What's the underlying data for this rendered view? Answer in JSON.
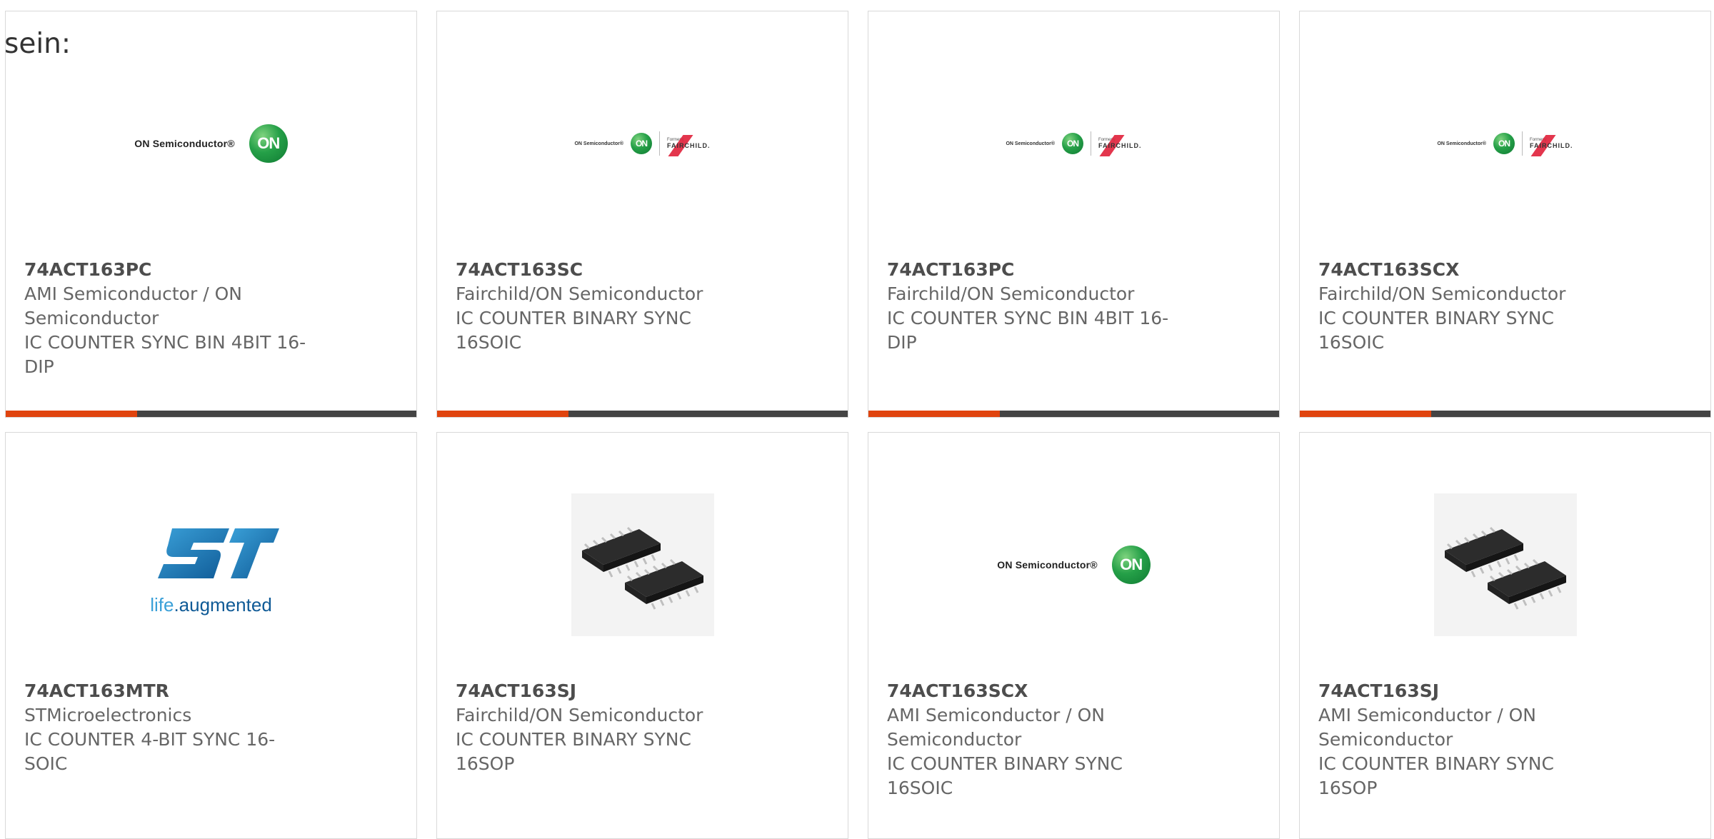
{
  "header_text": "sein:",
  "cards": [
    {
      "part": "74ACT163PC",
      "manufacturer": "AMI Semiconductor / ON Semiconductor",
      "description": "IC COUNTER SYNC BIN 4BIT 16-DIP",
      "logo": "on-semiconductor-logo",
      "logo_text": "ON Semiconductor®",
      "on_text": "ON",
      "progress": 0.32
    },
    {
      "part": "74ACT163SC",
      "manufacturer": "Fairchild/ON Semiconductor",
      "description": "IC COUNTER BINARY SYNC 16SOIC",
      "logo": "on-fairchild-logo",
      "logo_text": "ON Semiconductor®",
      "on_text": "ON",
      "formerly_text": "Formerly",
      "fairchild_text": "FAIRCHILD.",
      "progress": 0.32
    },
    {
      "part": "74ACT163PC",
      "manufacturer": "Fairchild/ON Semiconductor",
      "description": "IC COUNTER SYNC BIN 4BIT 16-DIP",
      "logo": "on-fairchild-logo",
      "logo_text": "ON Semiconductor®",
      "on_text": "ON",
      "formerly_text": "Formerly",
      "fairchild_text": "FAIRCHILD.",
      "progress": 0.32
    },
    {
      "part": "74ACT163SCX",
      "manufacturer": "Fairchild/ON Semiconductor",
      "description": "IC COUNTER BINARY SYNC 16SOIC",
      "logo": "on-fairchild-logo",
      "logo_text": "ON Semiconductor®",
      "on_text": "ON",
      "formerly_text": "Formerly",
      "fairchild_text": "FAIRCHILD.",
      "progress": 0.32
    },
    {
      "part": "74ACT163MTR",
      "manufacturer": "STMicroelectronics",
      "description": "IC COUNTER 4-BIT SYNC 16-SOIC",
      "logo": "st-logo",
      "st_tagline_a": "life",
      "st_tagline_b": ".augmented"
    },
    {
      "part": "74ACT163SJ",
      "manufacturer": "Fairchild/ON Semiconductor",
      "description": "IC COUNTER BINARY SYNC 16SOP",
      "logo": "ic-chip-image"
    },
    {
      "part": "74ACT163SCX",
      "manufacturer": "AMI Semiconductor / ON Semiconductor",
      "description": "IC COUNTER BINARY SYNC 16SOIC",
      "logo": "on-semiconductor-logo",
      "logo_text": "ON Semiconductor®",
      "on_text": "ON"
    },
    {
      "part": "74ACT163SJ",
      "manufacturer": "AMI Semiconductor / ON Semiconductor",
      "description": "IC COUNTER BINARY SYNC 16SOP",
      "logo": "ic-chip-image"
    }
  ],
  "colors": {
    "accent": "#e0440e",
    "track": "#444444",
    "border": "#d9d9d9",
    "text": "#666666"
  }
}
